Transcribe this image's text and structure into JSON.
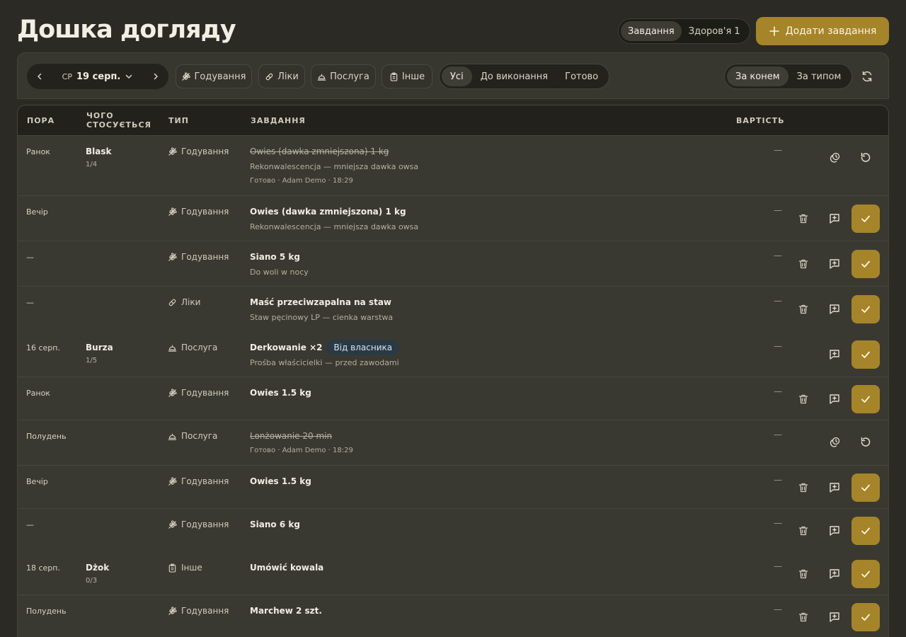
{
  "header": {
    "title": "Дошка догляду",
    "view_tabs": [
      {
        "label": "Завдання",
        "active": true
      },
      {
        "label": "Здоров'я",
        "count": "1",
        "active": false
      }
    ],
    "add_button": "Додати завдання",
    "accent_color": "#a5842a"
  },
  "toolbar": {
    "date": {
      "weekday": "СР",
      "date": "19 серп."
    },
    "type_filters": [
      "Годування",
      "Ліки",
      "Послуга",
      "Інше"
    ],
    "status_filters": [
      {
        "label": "Усі",
        "active": true
      },
      {
        "label": "До виконання",
        "active": false
      },
      {
        "label": "Готово",
        "active": false
      }
    ],
    "grouping": [
      {
        "label": "За конем",
        "active": true
      },
      {
        "label": "За типом",
        "active": false
      }
    ]
  },
  "table": {
    "columns": {
      "time": "ПОРА",
      "subject_line1": "ЧОГО",
      "subject_line2": "СТОСУЄТЬСЯ",
      "type": "ТИП",
      "task": "ЗАВДАННЯ",
      "cost": "ВАРТІСТЬ"
    },
    "rows": [
      {
        "time": "Ранок",
        "horse": "Blask",
        "progress": "1/4",
        "type": "Годування",
        "type_icon": "wheat-icon",
        "title": "Owies (dawka zmniejszona) 1 kg",
        "subtitle": "Rekonwalescencja — mniejsza dawka owsa",
        "meta": "Готово · Adam Demo · 18:29",
        "cost": "—",
        "done": true
      },
      {
        "time": "Вечір",
        "horse": "",
        "progress": "",
        "type": "Годування",
        "type_icon": "wheat-icon",
        "title": "Owies (dawka zmniejszona) 1 kg",
        "subtitle": "Rekonwalescencja — mniejsza dawka owsa",
        "meta": "",
        "cost": "—",
        "done": false
      },
      {
        "time": "—",
        "horse": "",
        "progress": "",
        "type": "Годування",
        "type_icon": "wheat-icon",
        "title": "Siano 5 kg",
        "subtitle": "Do woli w nocy",
        "meta": "",
        "cost": "—",
        "done": false
      },
      {
        "time": "—",
        "horse": "",
        "progress": "",
        "type": "Ліки",
        "type_icon": "pill-icon",
        "title": "Maść przeciwzapalna na staw",
        "subtitle": "Staw pęcinowy LP — cienka warstwa",
        "meta": "",
        "cost": "—",
        "done": false,
        "no_border": true
      },
      {
        "time": "16 серп.",
        "horse": "Burza",
        "progress": "1/5",
        "type": "Послуга",
        "type_icon": "service-bell-icon",
        "title": "Derkowanie ×2",
        "badge": "Від власника",
        "subtitle": "Prośba właścicielki — przed zawodami",
        "meta": "",
        "cost": "—",
        "done": false,
        "no_delete": true
      },
      {
        "time": "Ранок",
        "horse": "",
        "progress": "",
        "type": "Годування",
        "type_icon": "wheat-icon",
        "title": "Owies 1.5 kg",
        "subtitle": "",
        "meta": "",
        "cost": "—",
        "done": false
      },
      {
        "time": "Полудень",
        "horse": "",
        "progress": "",
        "type": "Послуга",
        "type_icon": "service-bell-icon",
        "title": "Lonżowanie 20 min",
        "subtitle": "",
        "meta": "Готово · Adam Demo · 18:29",
        "cost": "—",
        "done": true
      },
      {
        "time": "Вечір",
        "horse": "",
        "progress": "",
        "type": "Годування",
        "type_icon": "wheat-icon",
        "title": "Owies 1.5 kg",
        "subtitle": "",
        "meta": "",
        "cost": "—",
        "done": false
      },
      {
        "time": "—",
        "horse": "",
        "progress": "",
        "type": "Годування",
        "type_icon": "wheat-icon",
        "title": "Siano 6 kg",
        "subtitle": "",
        "meta": "",
        "cost": "—",
        "done": false,
        "no_border": true
      },
      {
        "time": "18 серп.",
        "horse": "Dżok",
        "progress": "0/3",
        "type": "Інше",
        "type_icon": "clipboard-icon",
        "title": "Umówić kowala",
        "subtitle": "",
        "meta": "",
        "cost": "—",
        "done": false
      },
      {
        "time": "Полудень",
        "horse": "",
        "progress": "",
        "type": "Годування",
        "type_icon": "wheat-icon",
        "title": "Marchew 2 szt.",
        "subtitle": "",
        "meta": "",
        "cost": "—",
        "done": false
      }
    ]
  }
}
